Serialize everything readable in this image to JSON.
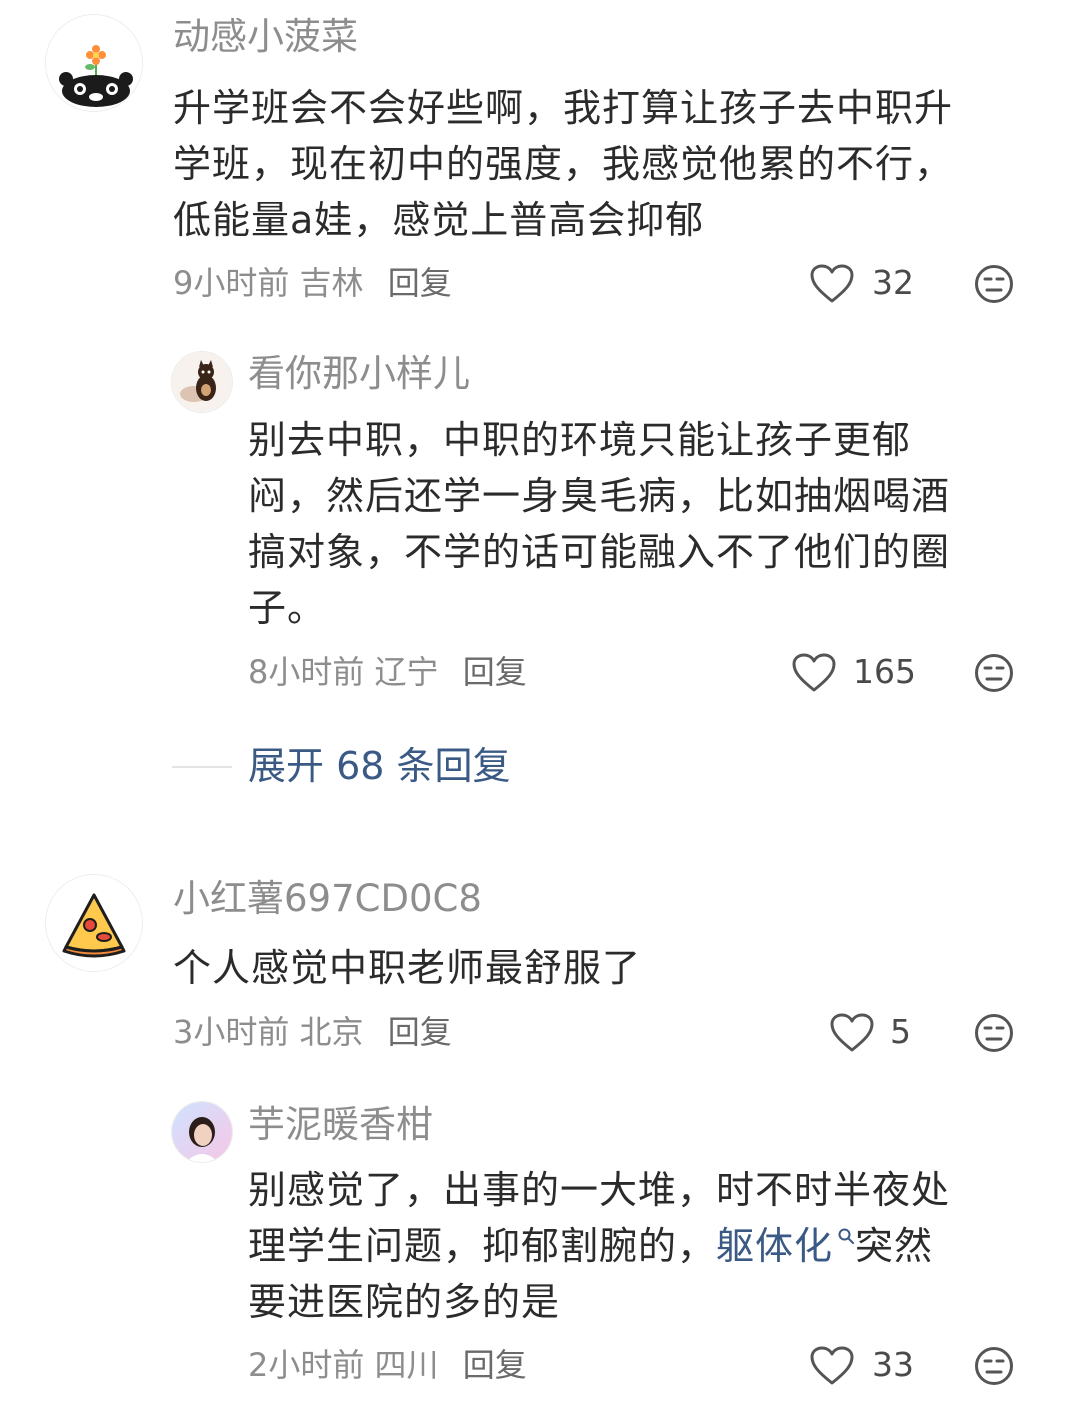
{
  "comments": [
    {
      "username": "动感小菠菜",
      "lines": [
        "升学班会不会好些啊，我打算让孩子去中职升",
        "学班，现在初中的强度，我感觉他累的不行，",
        "低能量a娃，感觉上普高会抑郁"
      ],
      "time": "9小时前",
      "location": "吉林",
      "reply_label": "回复",
      "likes": "32",
      "replies": [
        {
          "username": "看你那小样儿",
          "lines": [
            "别去中职，中职的环境只能让孩子更郁",
            "闷，然后还学一身臭毛病，比如抽烟喝酒",
            "搞对象，不学的话可能融入不了他们的圈",
            "子。"
          ],
          "time": "8小时前",
          "location": "辽宁",
          "reply_label": "回复",
          "likes": "165"
        }
      ],
      "expand_label": "展开 68 条回复"
    },
    {
      "username": "小红薯697CD0C8",
      "lines": [
        "个人感觉中职老师最舒服了"
      ],
      "time": "3小时前",
      "location": "北京",
      "reply_label": "回复",
      "likes": "5",
      "replies": [
        {
          "username": "芋泥暖香柑",
          "line1": "别感觉了，出事的一大堆，时不时半夜处",
          "line2_pre": "理学生问题，抑郁割腕的，",
          "keyword": "躯体化",
          "line2_post": "突然",
          "line3": "要进医院的多的是",
          "time": "2小时前",
          "location": "四川",
          "reply_label": "回复",
          "likes": "33"
        }
      ]
    }
  ],
  "colors": {
    "link": "#3a5a85",
    "meta": "#8d8d8d",
    "text": "#2b2b2b"
  },
  "icons": {
    "like": "heart-outline-icon",
    "dislike": "meh-face-icon"
  }
}
